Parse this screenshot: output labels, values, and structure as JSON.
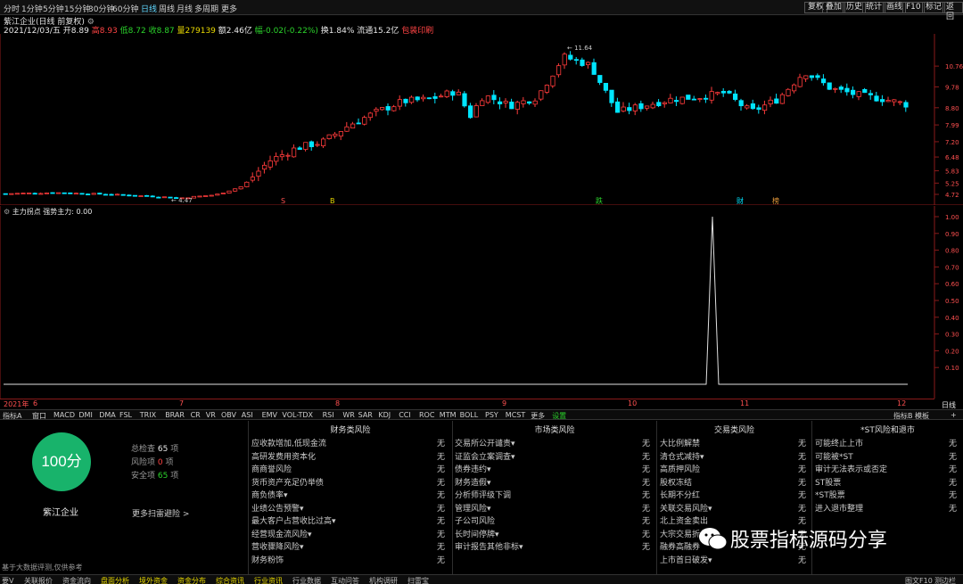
{
  "toolbar": {
    "periods": [
      "分时",
      "1分钟",
      "5分钟",
      "15分钟",
      "30分钟",
      "60分钟",
      "日线",
      "周线",
      "月线",
      "多周期",
      "更多"
    ],
    "active_period": "日线",
    "right_buttons": [
      "复权",
      "叠加",
      "历史",
      "统计",
      "画线",
      "F10",
      "标记",
      "返回"
    ]
  },
  "title": "紫江企业(日线 前复权)",
  "info": {
    "date": "2021/12/03/五",
    "open_label": "开",
    "open": "8.89",
    "high_label": "高",
    "high": "8.93",
    "low_label": "低",
    "low": "8.72",
    "close_label": "收",
    "close": "8.87",
    "volume_label": "量",
    "volume": "279139",
    "amount_label": "额",
    "amount": "2.46亿",
    "change_label": "幅",
    "change": "-0.02(-0.22%)",
    "turnover_label": "换",
    "turnover": "1.84%",
    "float_label": "流通",
    "float": "15.2亿",
    "tag": "包装印刷"
  },
  "chart_data": [
    {
      "type": "candlestick",
      "yticks": [
        "10.76",
        "9.78",
        "8.80",
        "7.99",
        "7.20",
        "6.48",
        "5.83",
        "5.25",
        "4.72"
      ],
      "annotations": [
        "11.64",
        "4.47"
      ],
      "markers": [
        "S",
        "B",
        "跌",
        "财",
        "榜"
      ],
      "x_ticks": [
        "2021年",
        "6",
        "7",
        "8",
        "9",
        "10",
        "11",
        "12"
      ]
    },
    {
      "type": "line",
      "title": "主力拐点",
      "series_name": "强势主力",
      "series_value": "0.00",
      "yticks": [
        "1.00",
        "0.90",
        "0.80",
        "0.70",
        "0.60",
        "0.50",
        "0.40",
        "0.30",
        "0.20",
        "0.10"
      ],
      "spike_value": 1.0
    }
  ],
  "right_axis_label": "日线",
  "indicator_tabs": [
    "指标A",
    "窗口",
    "MACD",
    "DMI",
    "DMA",
    "FSL",
    "TRIX",
    "BRAR",
    "CR",
    "VR",
    "OBV",
    "ASI",
    "EMV",
    "VOL-TDX",
    "RSI",
    "WR",
    "SAR",
    "KDJ",
    "CCI",
    "ROC",
    "MTM",
    "BOLL",
    "PSY",
    "MCST",
    "更多",
    "设置"
  ],
  "tabs_right": [
    "指标B",
    "模板",
    "+"
  ],
  "score": {
    "value": "100分",
    "company": "紫江企业",
    "check_label": "总检查",
    "check_count": "65",
    "check_unit": "项",
    "risk_label": "风险项",
    "risk_count": "0",
    "risk_unit": "项",
    "safe_label": "安全项",
    "safe_count": "65",
    "safe_unit": "项",
    "more": "更多扫雷避险 >",
    "note": "基于大数据评测,仅供参考"
  },
  "risk_columns": [
    {
      "title": "财务类风险",
      "items": [
        "应收款增加,低现金流",
        "高研发费用资本化",
        "商商誉风险",
        "货币资产充足仍举债",
        "商负债率▾",
        "业绩公告预警▾",
        "最大客户占营收比过高▾",
        "经营现金流风险▾",
        "营收骤降风险▾",
        "财务粉饰"
      ],
      "value": "无"
    },
    {
      "title": "市场类风险",
      "items": [
        "交易所公开谴责▾",
        "证监会立案调查▾",
        "债券违约▾",
        "财务造假▾",
        "分析师评级下调",
        "管理风险▾",
        "子公司风险",
        "长时间停牌▾",
        "审计报告其他非标▾"
      ],
      "value": "无"
    },
    {
      "title": "交易类风险",
      "items": [
        "大比例解禁",
        "清仓式减持▾",
        "高质押风险",
        "股权冻结",
        "长期不分红",
        "关联交易风险▾",
        "北上资金卖出",
        "大宗交易折价",
        "融券高融券",
        "上市首日破发▾"
      ],
      "value": "无"
    },
    {
      "title": "*ST风险和退市",
      "items": [
        "可能终止上市",
        "可能被*ST",
        "审计无法表示或否定",
        "ST股票",
        "*ST股票",
        "进入退市整理"
      ],
      "value": "无"
    }
  ],
  "watermark": "股票指标源码分享",
  "bottom_tabs": [
    "要V",
    "关联报价",
    "资金流向",
    "盘面分析",
    "境外资金",
    "资金分布",
    "综合资讯",
    "行业资讯",
    "行业数据",
    "互动问答",
    "机构调研",
    "扫雷宝"
  ],
  "bottom_right": [
    "图文F10",
    "测边栏"
  ]
}
